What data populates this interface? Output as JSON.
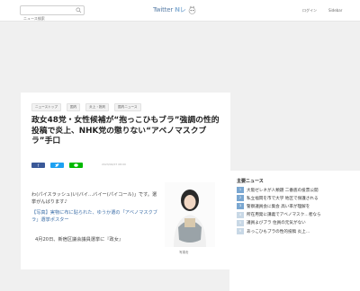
{
  "header": {
    "search_placeholder": "ニュース検索",
    "logo_main": "Twitter",
    "logo_accent": "Nレ",
    "login": "ログイン",
    "signup": "Sidebar"
  },
  "article": {
    "crumbs": [
      "ニューストップ",
      "国内",
      "炎上・批判",
      "国内ニュース"
    ],
    "title": "政女48党・女性候補が“抱っこひもブラ”強調の性的投稿で炎上、NHK党の懲りない“アベノマスクブラ”手口",
    "meta": [
      "2023/04/07",
      "08:00"
    ],
    "share": {
      "fb": "f",
      "tw": "",
      "line": ""
    },
    "lead": "わ(パイスラッシュ)\nコール」です。選挙",
    "lead_full": "わ(パイスラッシュ)い(バイ…バイー(パイコール)」です。選挙がんばります♪",
    "photo_caption_1": "【写真】実物に布に貼られた、ゆうか選の「アベノマスクブラ」選挙ポスター",
    "body": "4月20日、新宿区議会議員選挙に『政女』",
    "photo_label": "写真を"
  },
  "sidebar": {
    "title": "主要ニュース",
    "items": [
      "大阪ゼレネが人類題 二番底の投票公開",
      "私立福岡を市で大学 地区で保護される",
      "警察議員会に集会 高い率が理解を",
      "所在用発に講義でアベノマスク…者なら",
      "議員よびブラ 住員の元気がない",
      "あっこひもブラの性的投稿 炎上…"
    ]
  },
  "colors": {
    "facebook": "#3b5998",
    "twitter": "#1da1f2",
    "line": "#00b900",
    "logo": "#5a7fa8"
  }
}
